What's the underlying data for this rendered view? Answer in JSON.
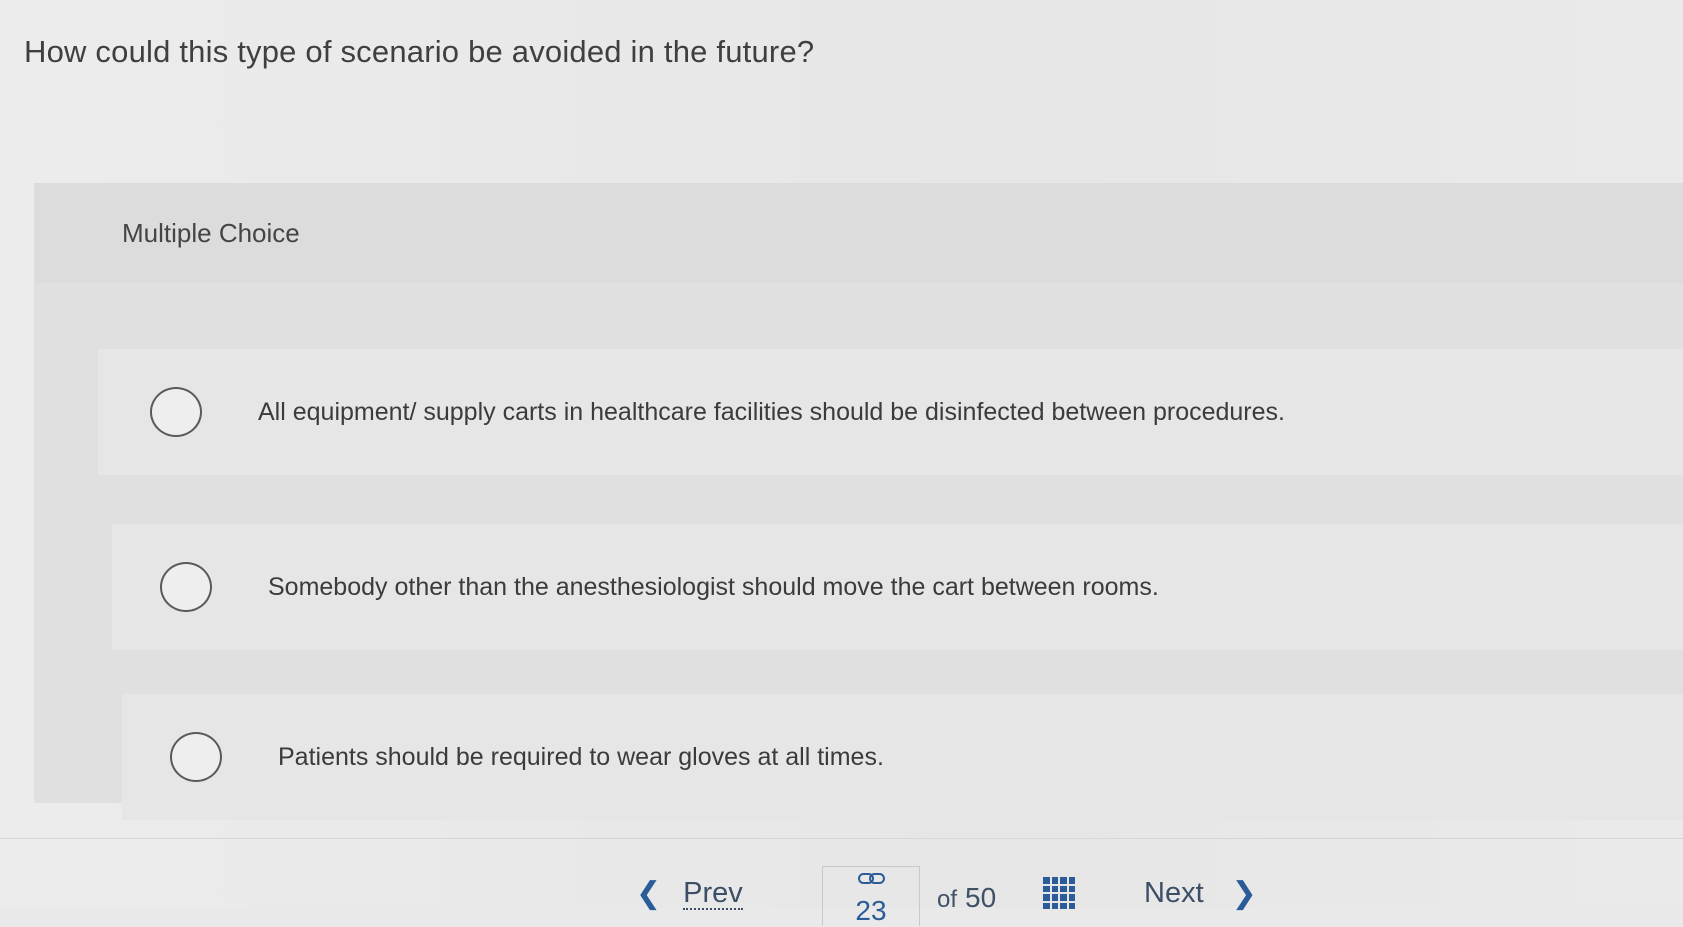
{
  "question": {
    "text": "How could this type of scenario be avoided in the future?"
  },
  "multiple_choice": {
    "label": "Multiple Choice",
    "options": [
      {
        "text": "All equipment/ supply carts in healthcare facilities should be disinfected between procedures.",
        "selected": false
      },
      {
        "text": "Somebody other than the anesthesiologist should move the cart between rooms.",
        "selected": false
      },
      {
        "text": "Patients should be required to wear gloves at all times.",
        "selected": false
      }
    ]
  },
  "navigation": {
    "prev_label": "Prev",
    "current_page": "23",
    "of_label": "of",
    "total_pages": "50",
    "next_label": "Next",
    "prev_icon": "chevron-left-icon",
    "next_icon": "chevron-right-icon",
    "link_icon": "link-icon",
    "grid_icon": "grid-icon"
  },
  "colors": {
    "accent": "#2b5c99",
    "text": "#3a3a3a",
    "panel_bg": "#e0e0e0"
  }
}
